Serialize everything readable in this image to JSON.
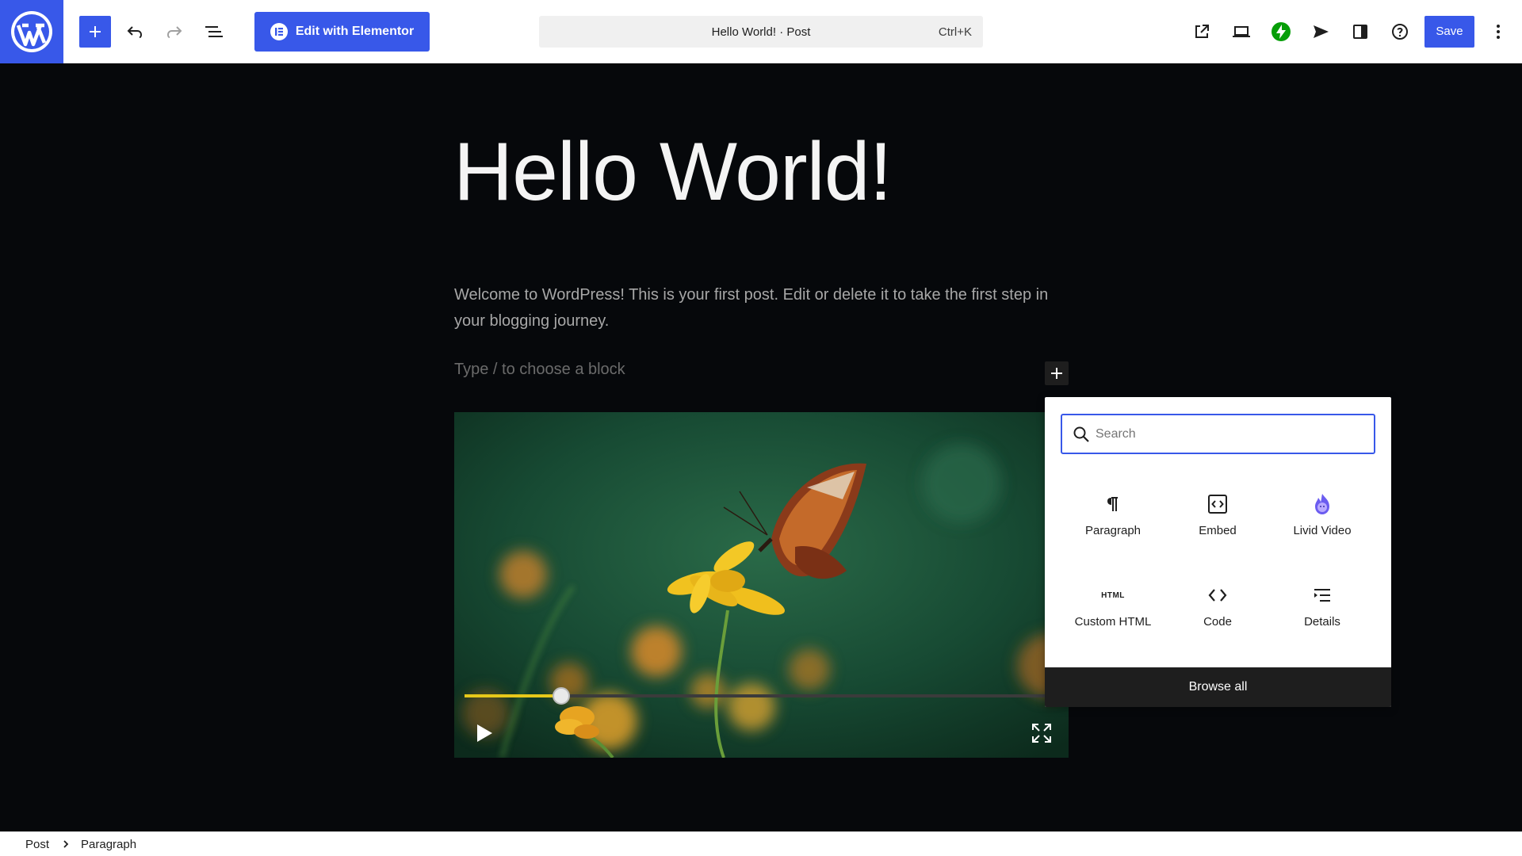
{
  "toolbar": {
    "elementor_label": "Edit with Elementor",
    "command_title": "Hello World! · Post",
    "command_shortcut": "Ctrl+K",
    "save_label": "Save",
    "accent_color": "#3858e9"
  },
  "post": {
    "title": "Hello World!",
    "paragraph": "Welcome to WordPress! This is your first post. Edit or delete it to take the first step in your blogging journey.",
    "placeholder": "Type / to choose a block"
  },
  "video": {
    "progress_fraction": 0.16,
    "progress_color": "#e6c81a"
  },
  "inserter": {
    "search_placeholder": "Search",
    "blocks": [
      {
        "label": "Paragraph",
        "icon": "paragraph-icon"
      },
      {
        "label": "Embed",
        "icon": "embed-icon"
      },
      {
        "label": "Livid Video",
        "icon": "livid-video-icon"
      },
      {
        "label": "Custom HTML",
        "icon": "html-icon"
      },
      {
        "label": "Code",
        "icon": "code-icon"
      },
      {
        "label": "Details",
        "icon": "details-icon"
      }
    ],
    "browse_all": "Browse all",
    "html_icon_text": "HTML"
  },
  "breadcrumb": {
    "items": [
      "Post",
      "Paragraph"
    ]
  }
}
